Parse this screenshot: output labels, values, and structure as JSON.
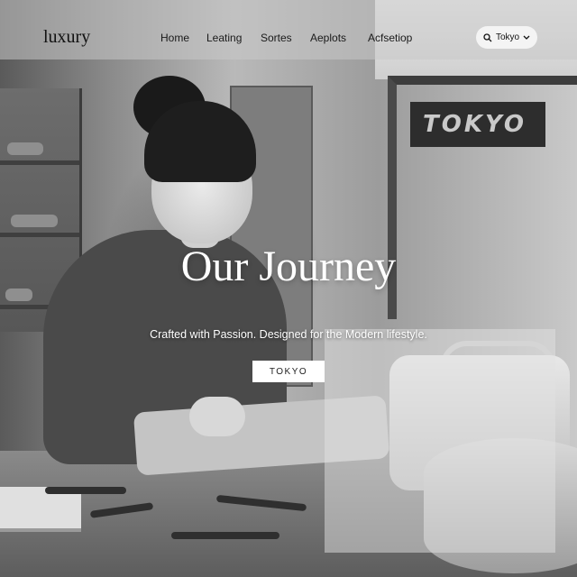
{
  "brand": {
    "logo": "luxury"
  },
  "nav": {
    "links": [
      "Home",
      "Leating",
      "Sortes",
      "Aeplots",
      "Acfsetiop"
    ],
    "language": {
      "label": "Tokyo",
      "icon": "search-icon",
      "caret": "chevron-down-icon"
    }
  },
  "hero": {
    "title": "Our Journey",
    "subtitle": "Crafted with Passion. Designed for the Modern lifestyle.",
    "cta_label": "TOKYO"
  },
  "background": {
    "sign_text": "TOKYO"
  }
}
